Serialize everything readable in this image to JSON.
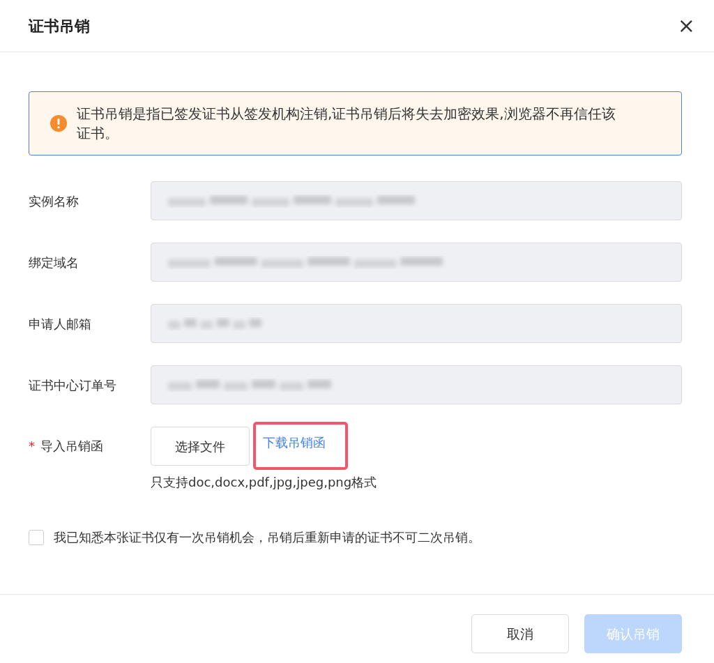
{
  "dialog": {
    "title": "证书吊销",
    "close": "×"
  },
  "alert": {
    "text": "证书吊销是指已签发证书从签发机构注销,证书吊销后将失去加密效果,浏览器不再信任该证书。"
  },
  "fields": [
    {
      "label": "实例名称",
      "redacted": true
    },
    {
      "label": "绑定域名",
      "redacted": true
    },
    {
      "label": "申请人邮箱",
      "redacted": true
    },
    {
      "label": "证书中心订单号",
      "redacted": true
    }
  ],
  "upload": {
    "required": true,
    "required_mark": "*",
    "label": "导入吊销函",
    "button": "选择文件",
    "link": {
      "text": "下载吊销函",
      "highlighted": true
    },
    "hint": "只支持doc,docx,pdf,jpg,jpeg,png格式"
  },
  "agreement": {
    "checked": false,
    "text": "我已知悉本张证书仅有一次吊销机会，吊销后重新申请的证书不可二次吊销。"
  },
  "buttons": [
    {
      "label": "取消",
      "kind": "secondary",
      "disabled": false
    },
    {
      "label": "确认吊销",
      "kind": "primary",
      "disabled": true
    }
  ]
}
